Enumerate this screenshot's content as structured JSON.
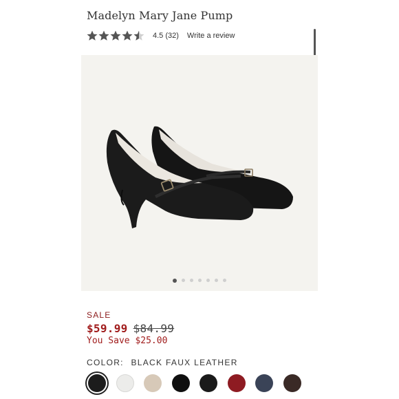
{
  "product": {
    "title": "Madelyn Mary Jane Pump",
    "rating_value": 4.5,
    "rating_text": "4.5",
    "review_count_text": "(32)",
    "write_review": "Write a review"
  },
  "gallery": {
    "image_count": 7,
    "active_index": 0
  },
  "pricing": {
    "sale_label": "SALE",
    "sale_price": "$59.99",
    "original_price": "$84.99",
    "you_save": "You Save $25.00"
  },
  "color": {
    "label": "COLOR:",
    "selected_name": "BLACK FAUX LEATHER",
    "swatches": [
      {
        "name": "black-faux-leather",
        "color": "#1c1c1c",
        "selected": true
      },
      {
        "name": "white",
        "color": "#ececea",
        "selected": false
      },
      {
        "name": "nude",
        "color": "#d7c9b8",
        "selected": false
      },
      {
        "name": "black-2",
        "color": "#0f0f0f",
        "selected": false
      },
      {
        "name": "black-3",
        "color": "#1a1a1a",
        "selected": false
      },
      {
        "name": "red",
        "color": "#8e1b22",
        "selected": false
      },
      {
        "name": "navy",
        "color": "#3a4357",
        "selected": false
      },
      {
        "name": "brown",
        "color": "#3a2a26",
        "selected": false
      }
    ]
  },
  "colors": {
    "sale_red": "#a11d1d",
    "sale_label": "#8b1a1a",
    "star": "#555555",
    "gallery_bg": "#f4f3ef"
  }
}
